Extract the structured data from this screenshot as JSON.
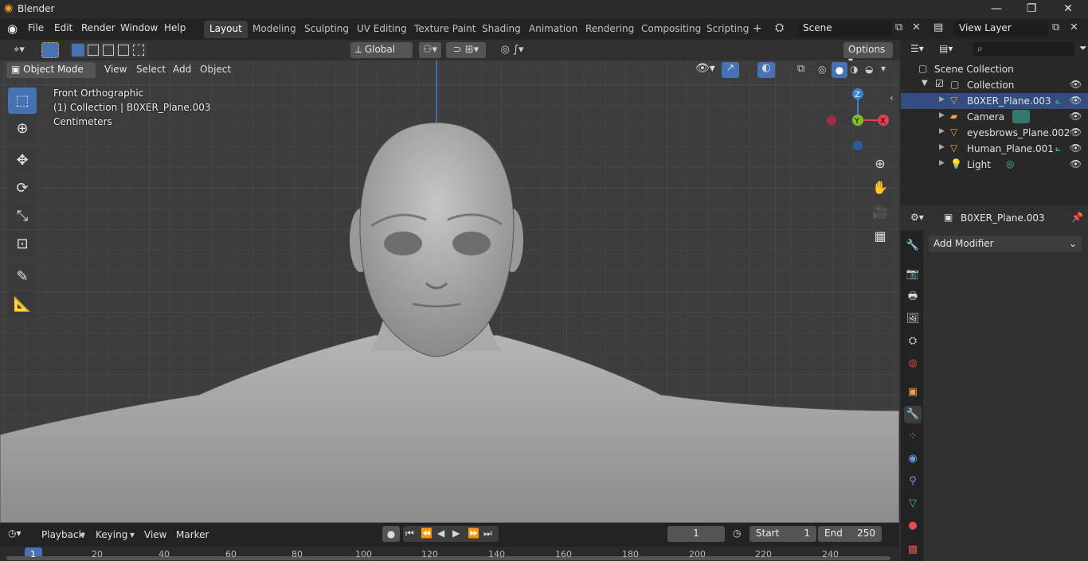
{
  "app": {
    "title": "Blender",
    "logo": "blender-logo-icon"
  },
  "window_controls": {
    "minimize": "—",
    "maximize": "❐",
    "close": "✕"
  },
  "menus": [
    "File",
    "Edit",
    "Render",
    "Window",
    "Help"
  ],
  "workspaces": [
    "Layout",
    "Modeling",
    "Sculpting",
    "UV Editing",
    "Texture Paint",
    "Shading",
    "Animation",
    "Rendering",
    "Compositing",
    "Scripting"
  ],
  "active_workspace": "Layout",
  "scene": {
    "label": "Scene"
  },
  "view_layer": {
    "label": "View Layer"
  },
  "header": {
    "transform_orientation": "Global",
    "options": "Options"
  },
  "viewport_header": {
    "mode": "Object Mode",
    "menus": [
      "View",
      "Select",
      "Add",
      "Object"
    ]
  },
  "viewport_overlay": {
    "view_name": "Front Orthographic",
    "collection_info": "(1) Collection | B0XER_Plane.003",
    "units": "Centimeters"
  },
  "gizmo": {
    "z": "Z",
    "y": "Y",
    "x": "X"
  },
  "outliner": {
    "root": "Scene Collection",
    "collection": "Collection",
    "items": [
      {
        "name": "B0XER_Plane.003",
        "icon": "mesh-icon",
        "selected": true
      },
      {
        "name": "Camera",
        "icon": "camera-icon",
        "selected": false
      },
      {
        "name": "eyesbrows_Plane.002",
        "icon": "mesh-icon",
        "selected": false
      },
      {
        "name": "Human_Plane.001",
        "icon": "mesh-icon",
        "selected": false
      },
      {
        "name": "Light",
        "icon": "light-icon",
        "selected": false
      }
    ]
  },
  "properties": {
    "object_name": "B0XER_Plane.003",
    "add_modifier": "Add Modifier"
  },
  "timeline": {
    "menus": [
      "Playback",
      "Keying",
      "View",
      "Marker"
    ],
    "current_frame": "1",
    "start_label": "Start",
    "start": "1",
    "end_label": "End",
    "end": "250",
    "ticks": [
      "1",
      "20",
      "40",
      "60",
      "80",
      "100",
      "120",
      "140",
      "160",
      "180",
      "200",
      "220",
      "240"
    ]
  },
  "colors": {
    "accent": "#4772b3",
    "selected_row": "#334d80",
    "x_axis": "#e04050",
    "y_axis": "#80c020",
    "z_axis": "#3a80d8"
  }
}
